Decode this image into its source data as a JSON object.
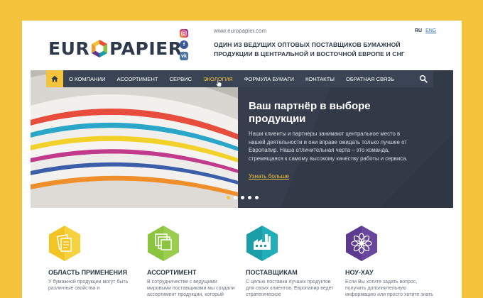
{
  "header": {
    "logo_left": "EUR",
    "logo_right": "PAPIER",
    "site_url": "www.europapier.com",
    "tagline": "ОДИН ИЗ ВЕДУЩИХ ОПТОВЫХ ПОСТАВЩИКОВ БУМАЖНОЙ ПРОДУКЦИИ В ЦЕНТРАЛЬНОЙ И ВОСТОЧНОЙ ЕВРОПЕ И СНГ",
    "lang_ru": "RU",
    "lang_en": "ENG",
    "socials": [
      "instagram-icon",
      "facebook-icon",
      "vk-icon"
    ]
  },
  "nav": {
    "items": [
      "О КОМПАНИИ",
      "АССОРТИМЕНТ",
      "СЕРВИС",
      "ЭКОЛОГИЯ",
      "ФОРМУЛА БУМАГИ",
      "КОНТАКТЫ",
      "ОБРАТНАЯ СВЯЗЬ"
    ],
    "active_index": 3
  },
  "hero": {
    "title": "Ваш партнёр в выборе продукции",
    "text": "Наши клиенты и партнеры занимают центральное место в нашей деятельности и они вправе ожидать только лучшее от Европапир. Наша отличительная черта – это команда, стремящаяся к самому высокому качеству работы и сервиса.",
    "link": "Узнать больше",
    "slides": 5,
    "active_slide": 0
  },
  "features": [
    {
      "title": "ОБЛАСТЬ ПРИМЕНЕНИЯ",
      "text": "У бумажной продукции могут быть различные свойства и",
      "color": "#f2c524",
      "icon": "documents-icon"
    },
    {
      "title": "АССОРТИМЕНТ",
      "text": "В сотрудничестве с ведущими мировыми поставщиками мы создали ассортимент продукции, который",
      "color": "#8cc43f",
      "icon": "stacked-sheets-icon"
    },
    {
      "title": "ПОСТАВЩИКАМ",
      "text": "С целью поставки лучших продуктов для своих клиентов, Европапир ведет стратегическое",
      "color": "#1b9ea7",
      "icon": "factory-icon"
    },
    {
      "title": "НОУ-ХАУ",
      "text": "Если Вы хотите задать вопрос, получить дополнительную информацию или просто хотите знать",
      "color": "#5b3a8f",
      "icon": "flower-icon"
    }
  ],
  "colors": {
    "accent": "#f5c33b",
    "nav_bg": "#3b4454",
    "hero_bg": "#343b4a",
    "text_dark": "#2e3a4b"
  }
}
